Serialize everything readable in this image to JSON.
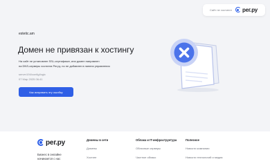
{
  "badge": {
    "text": "Сайт не хостинге",
    "logo": "рег.ру"
  },
  "domain": "estetic.am",
  "title": "Домен не привязан к хостингу",
  "description": [
    "На сайт не установлен SSL-сертификат, или домен направлен",
    "на DNS-серверы хостинга Рег.ру, но не добавлен в панели управления"
  ],
  "meta": {
    "server": "server194/config/logic",
    "timestamp": "07 Мар 2025 06:41"
  },
  "cta_label": "Как исправить эту ошибку",
  "footer": {
    "logo": "рег.ру",
    "tagline": [
      "Бизнес в онлайне",
      "начинается с нас"
    ],
    "columns": [
      {
        "heading": "Домены в сети",
        "items": [
          "Домены",
          "Хостинг"
        ]
      },
      {
        "heading": "Облака и IT-инфраструктура",
        "items": [
          "Облачные серверы",
          "Частное облако"
        ]
      },
      {
        "heading": "Полезное",
        "items": [
          "Новости компании",
          "Новости технологий и медиа"
        ]
      }
    ]
  },
  "colors": {
    "accent": "#2f5fe6",
    "background": "#f3f4f7",
    "illustration_light": "#c9d3f6",
    "illustration_badge": "#4b73ea"
  },
  "icons": [
    "regru-logo-icon",
    "broken-page-illustration"
  ]
}
